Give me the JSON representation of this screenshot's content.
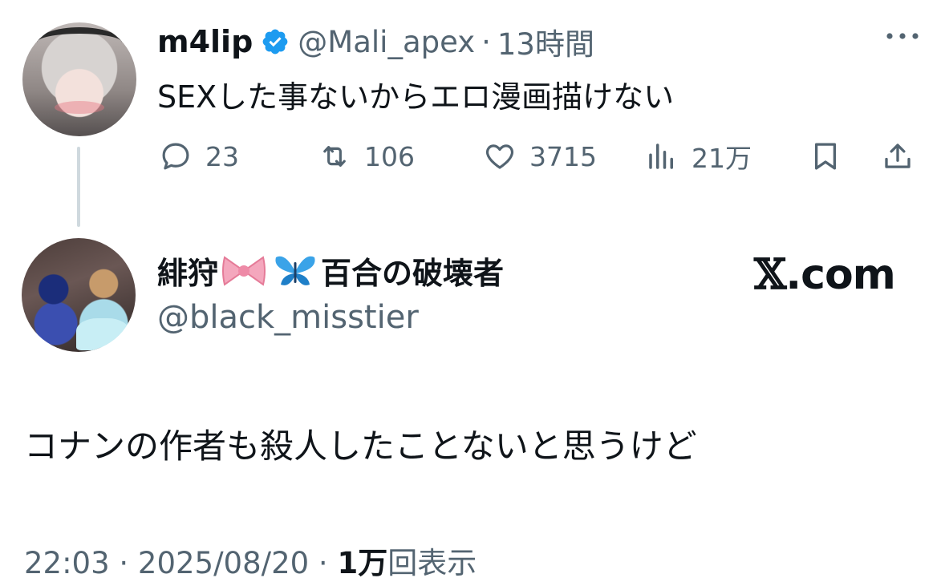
{
  "original_tweet": {
    "display_name": "m4lip",
    "handle": "@Mali_apex",
    "separator": "·",
    "time": "13時間",
    "text": "SEXした事ないからエロ漫画描けない",
    "actions": {
      "replies": "23",
      "retweets": "106",
      "likes": "3715",
      "views": "21万"
    }
  },
  "reply_tweet": {
    "display_name_prefix": "緋狩",
    "display_name_suffix": "百合の破壊者",
    "handle": "@black_misstier",
    "brand": ".com",
    "brand_mark": "𝕏",
    "text": "コナンの作者も殺人したことないと思うけど",
    "timestamp": "22:03 · 2025/08/20 · ",
    "view_count": "1万",
    "view_label": "回表示"
  },
  "colors": {
    "text": "#0f1419",
    "secondary": "#536471",
    "verified": "#1d9bf0",
    "thread_line": "#cfd9de"
  },
  "icons": [
    "verified-badge-icon",
    "more-icon",
    "reply-icon",
    "retweet-icon",
    "like-icon",
    "views-icon",
    "bookmark-icon",
    "share-icon",
    "ribbon-emoji",
    "butterfly-emoji"
  ]
}
